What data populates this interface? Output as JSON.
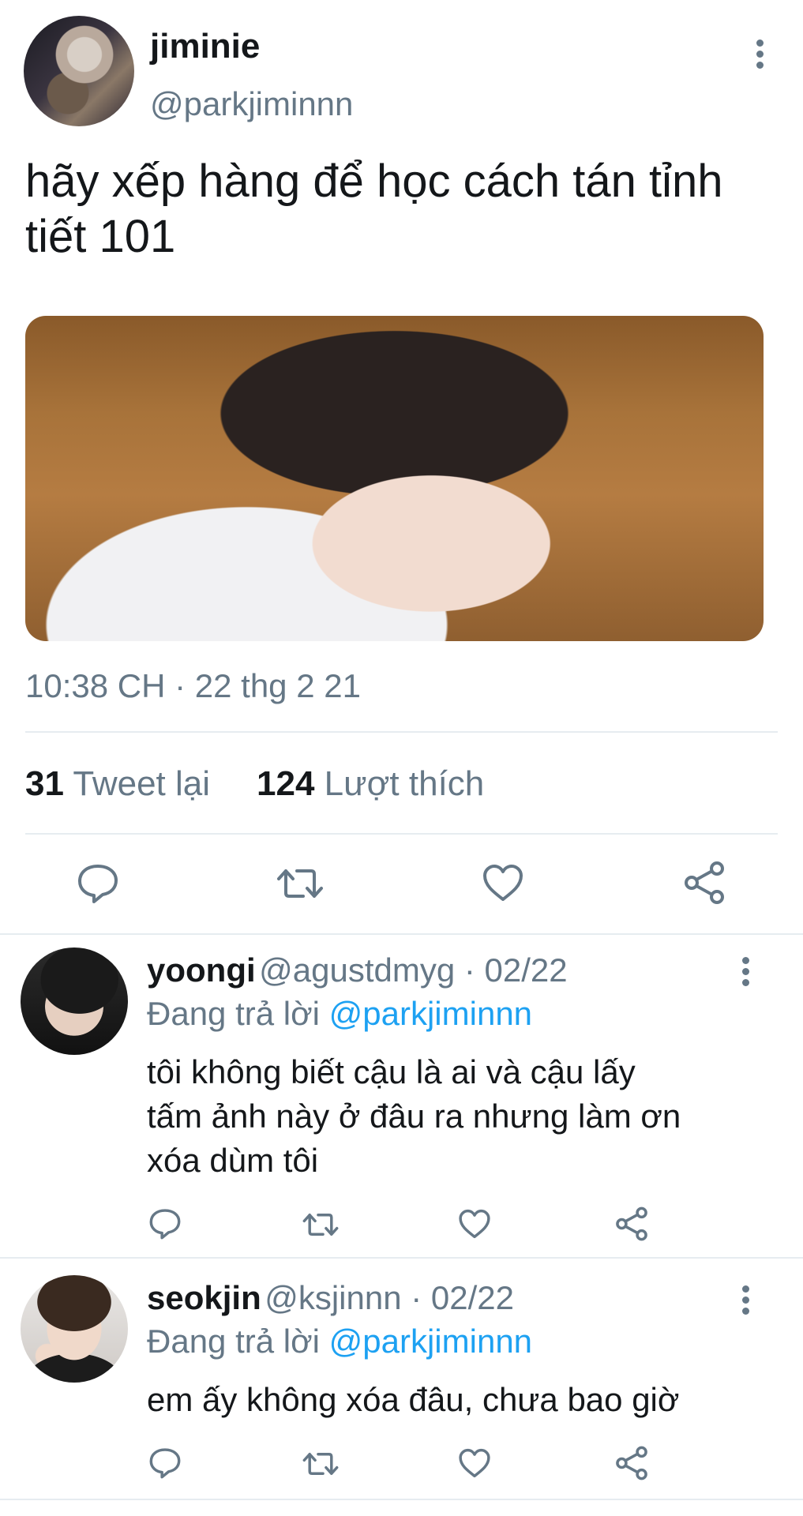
{
  "tweet": {
    "author_name": "jiminie",
    "author_handle": "@parkjiminnn",
    "text_line1": "hãy xếp hàng để học cách tán tỉnh",
    "text_line2": "tiết 101",
    "timestamp": "10:38 CH · 22 thg 2 21",
    "retweet_count": "31",
    "retweet_label": "Tweet lại",
    "like_count": "124",
    "like_label": "Lượt thích"
  },
  "actions": {
    "reply_icon": "reply-icon",
    "retweet_icon": "retweet-icon",
    "like_icon": "heart-icon",
    "share_icon": "share-icon"
  },
  "replies": [
    {
      "name": "yoongi",
      "handle": "@agustdmyg",
      "date": " · 02/22",
      "replying_prefix": "Đang trả lời ",
      "replying_to": "@parkjiminnn",
      "text_lines": [
        "tôi không biết cậu là ai và cậu lấy",
        "tấm ảnh này ở đâu ra nhưng làm ơn",
        "xóa dùm tôi"
      ]
    },
    {
      "name": "seokjin",
      "handle": "@ksjinnn",
      "date": " · 02/22",
      "replying_prefix": "Đang trả lời ",
      "replying_to": "@parkjiminnn",
      "text_lines": [
        "em ấy không xóa đâu, chưa bao giờ"
      ]
    }
  ],
  "colors": {
    "text": "#14171a",
    "secondary": "#657786",
    "link": "#1da1f2",
    "divider": "#e6ecf0"
  }
}
